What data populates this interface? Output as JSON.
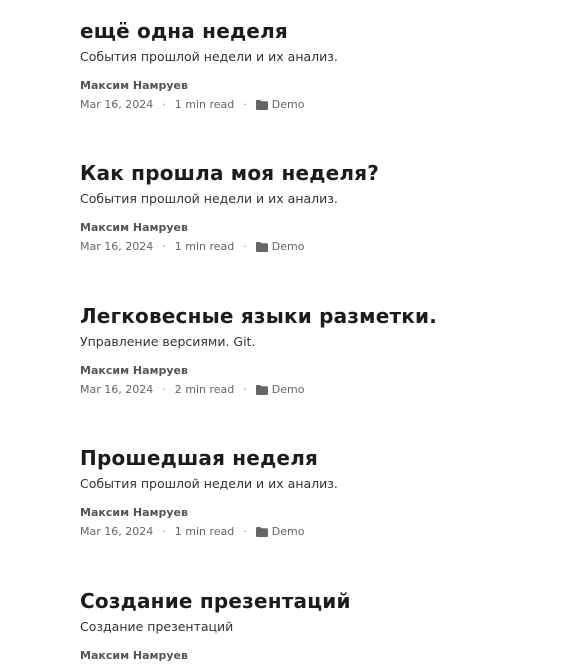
{
  "posts": [
    {
      "title": "ещё одна неделя",
      "summary": "События прошлой недели и их анализ.",
      "author": "Максим Намруев",
      "date": "Mar 16, 2024",
      "reading_time": "1 min read",
      "category": "Demo"
    },
    {
      "title": "Как прошла моя неделя?",
      "summary": "События прошлой недели и их анализ.",
      "author": "Максим Намруев",
      "date": "Mar 16, 2024",
      "reading_time": "1 min read",
      "category": "Demo"
    },
    {
      "title": "Легковесные языки разметки.",
      "summary": "Управление версиями. Git.",
      "author": "Максим Намруев",
      "date": "Mar 16, 2024",
      "reading_time": "2 min read",
      "category": "Demo"
    },
    {
      "title": "Прошедшая неделя",
      "summary": "События прошлой недели и их анализ.",
      "author": "Максим Намруев",
      "date": "Mar 16, 2024",
      "reading_time": "1 min read",
      "category": "Demo"
    },
    {
      "title": "Создание презентаций",
      "summary": "Создание презентаций",
      "author": "Максим Намруев"
    }
  ],
  "separator": "·",
  "icons": {
    "category": "folder-icon"
  }
}
